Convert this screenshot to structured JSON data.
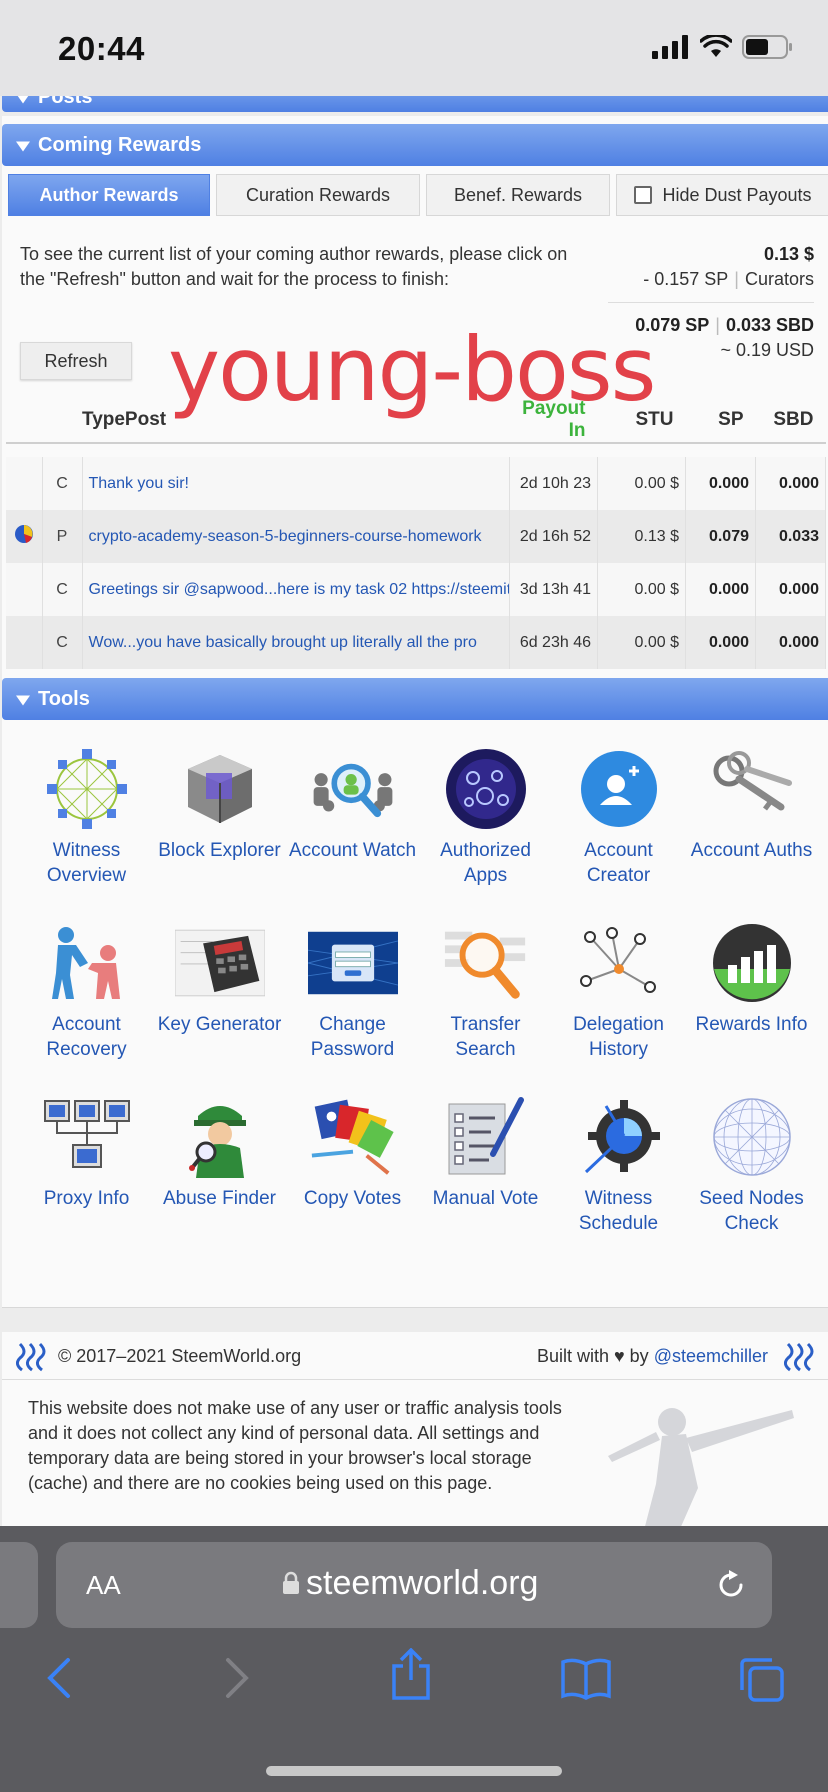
{
  "status": {
    "time": "20:44"
  },
  "sections": {
    "posts": "Posts",
    "coming_rewards": "Coming Rewards",
    "tools": "Tools"
  },
  "tabs": [
    {
      "label": "Author Rewards",
      "active": true
    },
    {
      "label": "Curation Rewards",
      "active": false
    },
    {
      "label": "Benef. Rewards",
      "active": false
    },
    {
      "label": "Hide Dust Payouts",
      "active": false
    }
  ],
  "info": {
    "text": "To see the current list of your coming author rewards, please click on the \"Refresh\" button and wait for the process to finish:",
    "total_usd": "0.13 $",
    "curators_sp": "- 0.157 SP",
    "curators_label": "Curators",
    "sp": "0.079 SP",
    "sbd": "0.033 SBD",
    "usd": "~ 0.19 USD",
    "refresh": "Refresh",
    "watermark": "young-boss"
  },
  "table": {
    "headers": {
      "typepost": "TypePost",
      "payout": "Payout In",
      "stu": "STU",
      "sp": "SP",
      "sbd": "SBD"
    },
    "rows": [
      {
        "type": "C",
        "post": "Thank you sir!",
        "payout": "2d 10h 23",
        "stu": "0.00 $",
        "sp": "0.000",
        "sbd": "0.000"
      },
      {
        "type": "P",
        "post": "crypto-academy-season-5-beginners-course-homework",
        "payout": "2d 16h 52",
        "stu": "0.13 $",
        "sp": "0.079",
        "sbd": "0.033"
      },
      {
        "type": "C",
        "post": "Greetings sir @sapwood...here is my task 02 https://steemit",
        "payout": "3d 13h 41",
        "stu": "0.00 $",
        "sp": "0.000",
        "sbd": "0.000"
      },
      {
        "type": "C",
        "post": "Wow...you have basically brought up literally all the pro",
        "payout": "6d 23h 46",
        "stu": "0.00 $",
        "sp": "0.000",
        "sbd": "0.000"
      }
    ]
  },
  "tools": [
    {
      "label": "Witness Overview",
      "icon": "witness-overview-icon"
    },
    {
      "label": "Block Explorer",
      "icon": "block-explorer-icon"
    },
    {
      "label": "Account Watch",
      "icon": "account-watch-icon"
    },
    {
      "label": "Authorized Apps",
      "icon": "authorized-apps-icon"
    },
    {
      "label": "Account Creator",
      "icon": "account-creator-icon"
    },
    {
      "label": "Account Auths",
      "icon": "keys-icon"
    },
    {
      "label": "Account Recovery",
      "icon": "account-recovery-icon"
    },
    {
      "label": "Key Generator",
      "icon": "calculator-icon"
    },
    {
      "label": "Change Password",
      "icon": "login-form-icon"
    },
    {
      "label": "Transfer Search",
      "icon": "magnifier-icon"
    },
    {
      "label": "Delegation History",
      "icon": "network-icon"
    },
    {
      "label": "Rewards Info",
      "icon": "bar-chart-icon"
    },
    {
      "label": "Proxy Info",
      "icon": "proxy-icon"
    },
    {
      "label": "Abuse Finder",
      "icon": "detective-icon"
    },
    {
      "label": "Copy Votes",
      "icon": "cards-icon"
    },
    {
      "label": "Manual Vote",
      "icon": "checklist-icon"
    },
    {
      "label": "Witness Schedule",
      "icon": "gear-clock-icon"
    },
    {
      "label": "Seed Nodes Check",
      "icon": "globe-mesh-icon"
    }
  ],
  "footer": {
    "copyright": "© 2017–2021 SteemWorld.org",
    "built_with": "Built with ♥ by ",
    "author": "@steemchiller",
    "privacy": "This website does not make use of any user or traffic analysis tools and it does not collect any kind of personal data. All settings and temporary data are being stored in your browser's local storage (cache) and there are no cookies being used on this page."
  },
  "browser": {
    "aa": "AA",
    "host": "steemworld.org"
  },
  "colors": {
    "accent": "#4f80e3",
    "link": "#2457b4",
    "payout_header": "#3cb33c",
    "watermark": "#e24149"
  }
}
